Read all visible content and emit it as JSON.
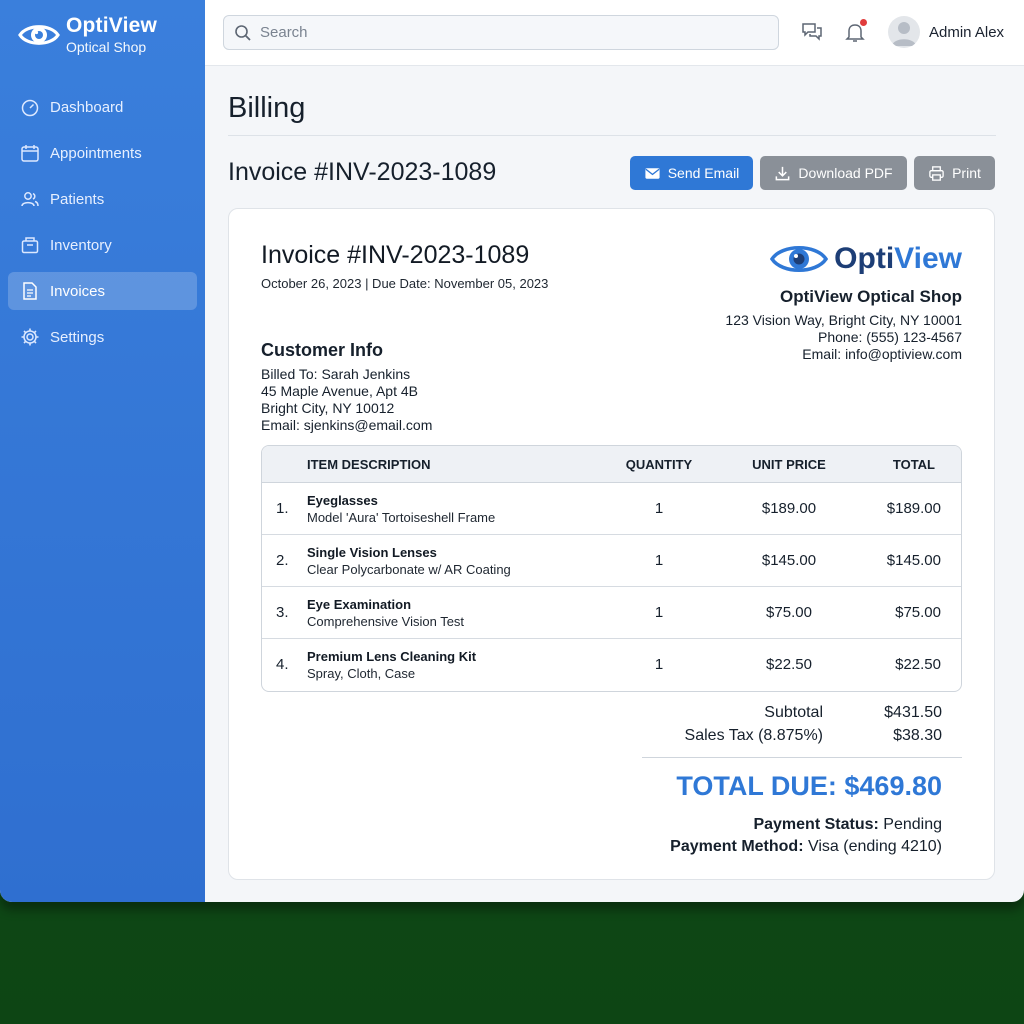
{
  "brand": {
    "name": "OptiView",
    "subtitle": "Optical Shop"
  },
  "sidebar": {
    "items": [
      {
        "label": "Dashboard",
        "icon": "dashboard-icon",
        "active": false
      },
      {
        "label": "Appointments",
        "icon": "calendar-icon",
        "active": false
      },
      {
        "label": "Patients",
        "icon": "users-icon",
        "active": false
      },
      {
        "label": "Inventory",
        "icon": "box-icon",
        "active": false
      },
      {
        "label": "Invoices",
        "icon": "document-icon",
        "active": true
      },
      {
        "label": "Settings",
        "icon": "gear-icon",
        "active": false
      }
    ]
  },
  "header": {
    "search_placeholder": "Search",
    "user_name": "Admin Alex",
    "icons": [
      "chat-icon",
      "bell-icon",
      "avatar"
    ]
  },
  "page": {
    "title": "Billing",
    "invoice_heading": "Invoice #INV-2023-1089",
    "buttons": {
      "send_email": "Send Email",
      "download_pdf": "Download PDF",
      "print": "Print"
    }
  },
  "invoice": {
    "title": "Invoice #INV-2023-1089",
    "dates": "October 26, 2023 | Due Date: November 05, 2023",
    "logo_text_1": "Opti",
    "logo_text_2": "View",
    "shop": {
      "name": "OptiView Optical Shop",
      "address": "123 Vision Way, Bright City, NY 10001",
      "phone": "Phone: (555) 123-4567",
      "email": "Email: info@optiview.com"
    },
    "customer": {
      "heading": "Customer Info",
      "billed_to": "Billed To: Sarah Jenkins",
      "address1": "45 Maple Avenue, Apt 4B",
      "address2": "Bright City, NY 10012",
      "email": "Email: sjenkins@email.com"
    },
    "table": {
      "headers": {
        "description": "ITEM DESCRIPTION",
        "quantity": "QUANTITY",
        "unit_price": "UNIT PRICE",
        "total": "TOTAL"
      },
      "rows": [
        {
          "num": "1.",
          "name": "Eyeglasses",
          "desc": "Model 'Aura' Tortoiseshell Frame",
          "qty": "1",
          "price": "$189.00",
          "total": "$189.00"
        },
        {
          "num": "2.",
          "name": "Single Vision Lenses",
          "desc": "Clear Polycarbonate w/ AR Coating",
          "qty": "1",
          "price": "$145.00",
          "total": "$145.00"
        },
        {
          "num": "3.",
          "name": "Eye Examination",
          "desc": "Comprehensive Vision Test",
          "qty": "1",
          "price": "$75.00",
          "total": "$75.00"
        },
        {
          "num": "4.",
          "name": "Premium Lens Cleaning Kit",
          "desc": "Spray, Cloth, Case",
          "qty": "1",
          "price": "$22.50",
          "total": "$22.50"
        }
      ]
    },
    "summary": {
      "subtotal_label": "Subtotal",
      "subtotal": "$431.50",
      "tax_label": "Sales Tax (8.875%)",
      "tax": "$38.30",
      "total_due": "TOTAL DUE: $469.80",
      "status_label": "Payment Status:",
      "status": "Pending",
      "method_label": "Payment Method:",
      "method": "Visa (ending 4210)"
    }
  },
  "colors": {
    "sidebar": "#3a7fdc",
    "accent": "#2f78d6",
    "gray_button": "#8a9098",
    "brand_dark": "#1d3e76"
  }
}
